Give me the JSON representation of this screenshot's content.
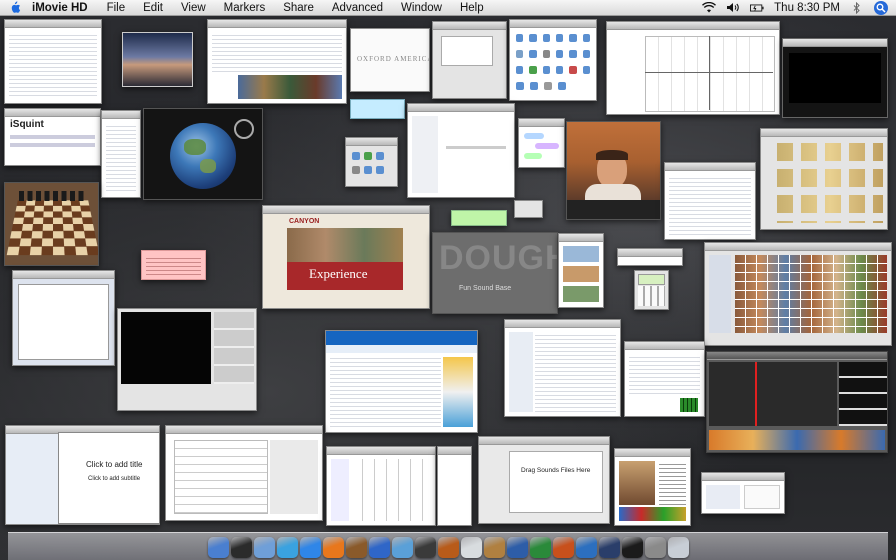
{
  "menubar": {
    "app_name": "iMovie HD",
    "menus": [
      "File",
      "Edit",
      "View",
      "Markers",
      "Share",
      "Advanced",
      "Window",
      "Help"
    ],
    "clock": "Thu 8:30 PM",
    "status_icons": [
      "wifi-icon",
      "volume-icon",
      "battery-icon",
      "bluetooth-icon",
      "spotlight-icon"
    ]
  },
  "windows": {
    "isquint_title": "iSquint",
    "oxford_text": "OXFORD AMERICAN",
    "canyon_logo": "CANYON",
    "experience_text": "Experience",
    "dough_text": "DOUGH",
    "fun_text": "Fun Sound Base",
    "ppt_title": "Click to add title",
    "ppt_subtitle": "Click to add subtitle",
    "drag_text": "Drag Sounds Files Here"
  },
  "dock": {
    "icons": [
      "finder-icon",
      "dashboard-icon",
      "mail-icon",
      "ichat-icon",
      "safari-icon",
      "firefox-icon",
      "camino-icon",
      "itunes-icon",
      "iphoto-icon",
      "imovie-icon",
      "garageband-icon",
      "ical-icon",
      "address-book-icon",
      "word-icon",
      "excel-icon",
      "powerpoint-icon",
      "entourage-icon",
      "photoshop-icon",
      "terminal-icon",
      "system-preferences-icon",
      "trash-icon"
    ],
    "colors": [
      "#4a7fd0",
      "#2b2b2b",
      "#6f9fd8",
      "#3aa2e0",
      "#2f86e8",
      "#e8771c",
      "#8a5a2a",
      "#2f66c8",
      "#5aa0d8",
      "#3a3a3a",
      "#b85b1a",
      "#d8dcdf",
      "#b08040",
      "#2d5da8",
      "#2a8a3a",
      "#c8501c",
      "#2c6fbf",
      "#2a3e6a",
      "#1b1b1b",
      "#8a8a8a",
      "#c8ced6"
    ]
  }
}
